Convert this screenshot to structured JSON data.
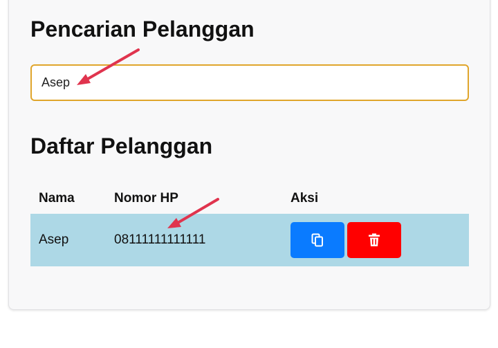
{
  "search_section": {
    "title": "Pencarian Pelanggan",
    "search_value": "Asep"
  },
  "list_section": {
    "title": "Daftar Pelanggan",
    "columns": [
      "Nama",
      "Nomor HP",
      "Aksi"
    ],
    "rows": [
      {
        "nama": "Asep",
        "nomor_hp": "08111111111111"
      }
    ]
  },
  "icons": {
    "copy": "copy-icon",
    "delete": "trash-icon",
    "annotation": "arrow-annotation"
  },
  "colors": {
    "search_border": "#e0a52b",
    "row_highlight": "#add8e6",
    "copy_button": "#0a7bff",
    "delete_button": "#ff0000",
    "annotation_arrow": "#e0344e"
  }
}
